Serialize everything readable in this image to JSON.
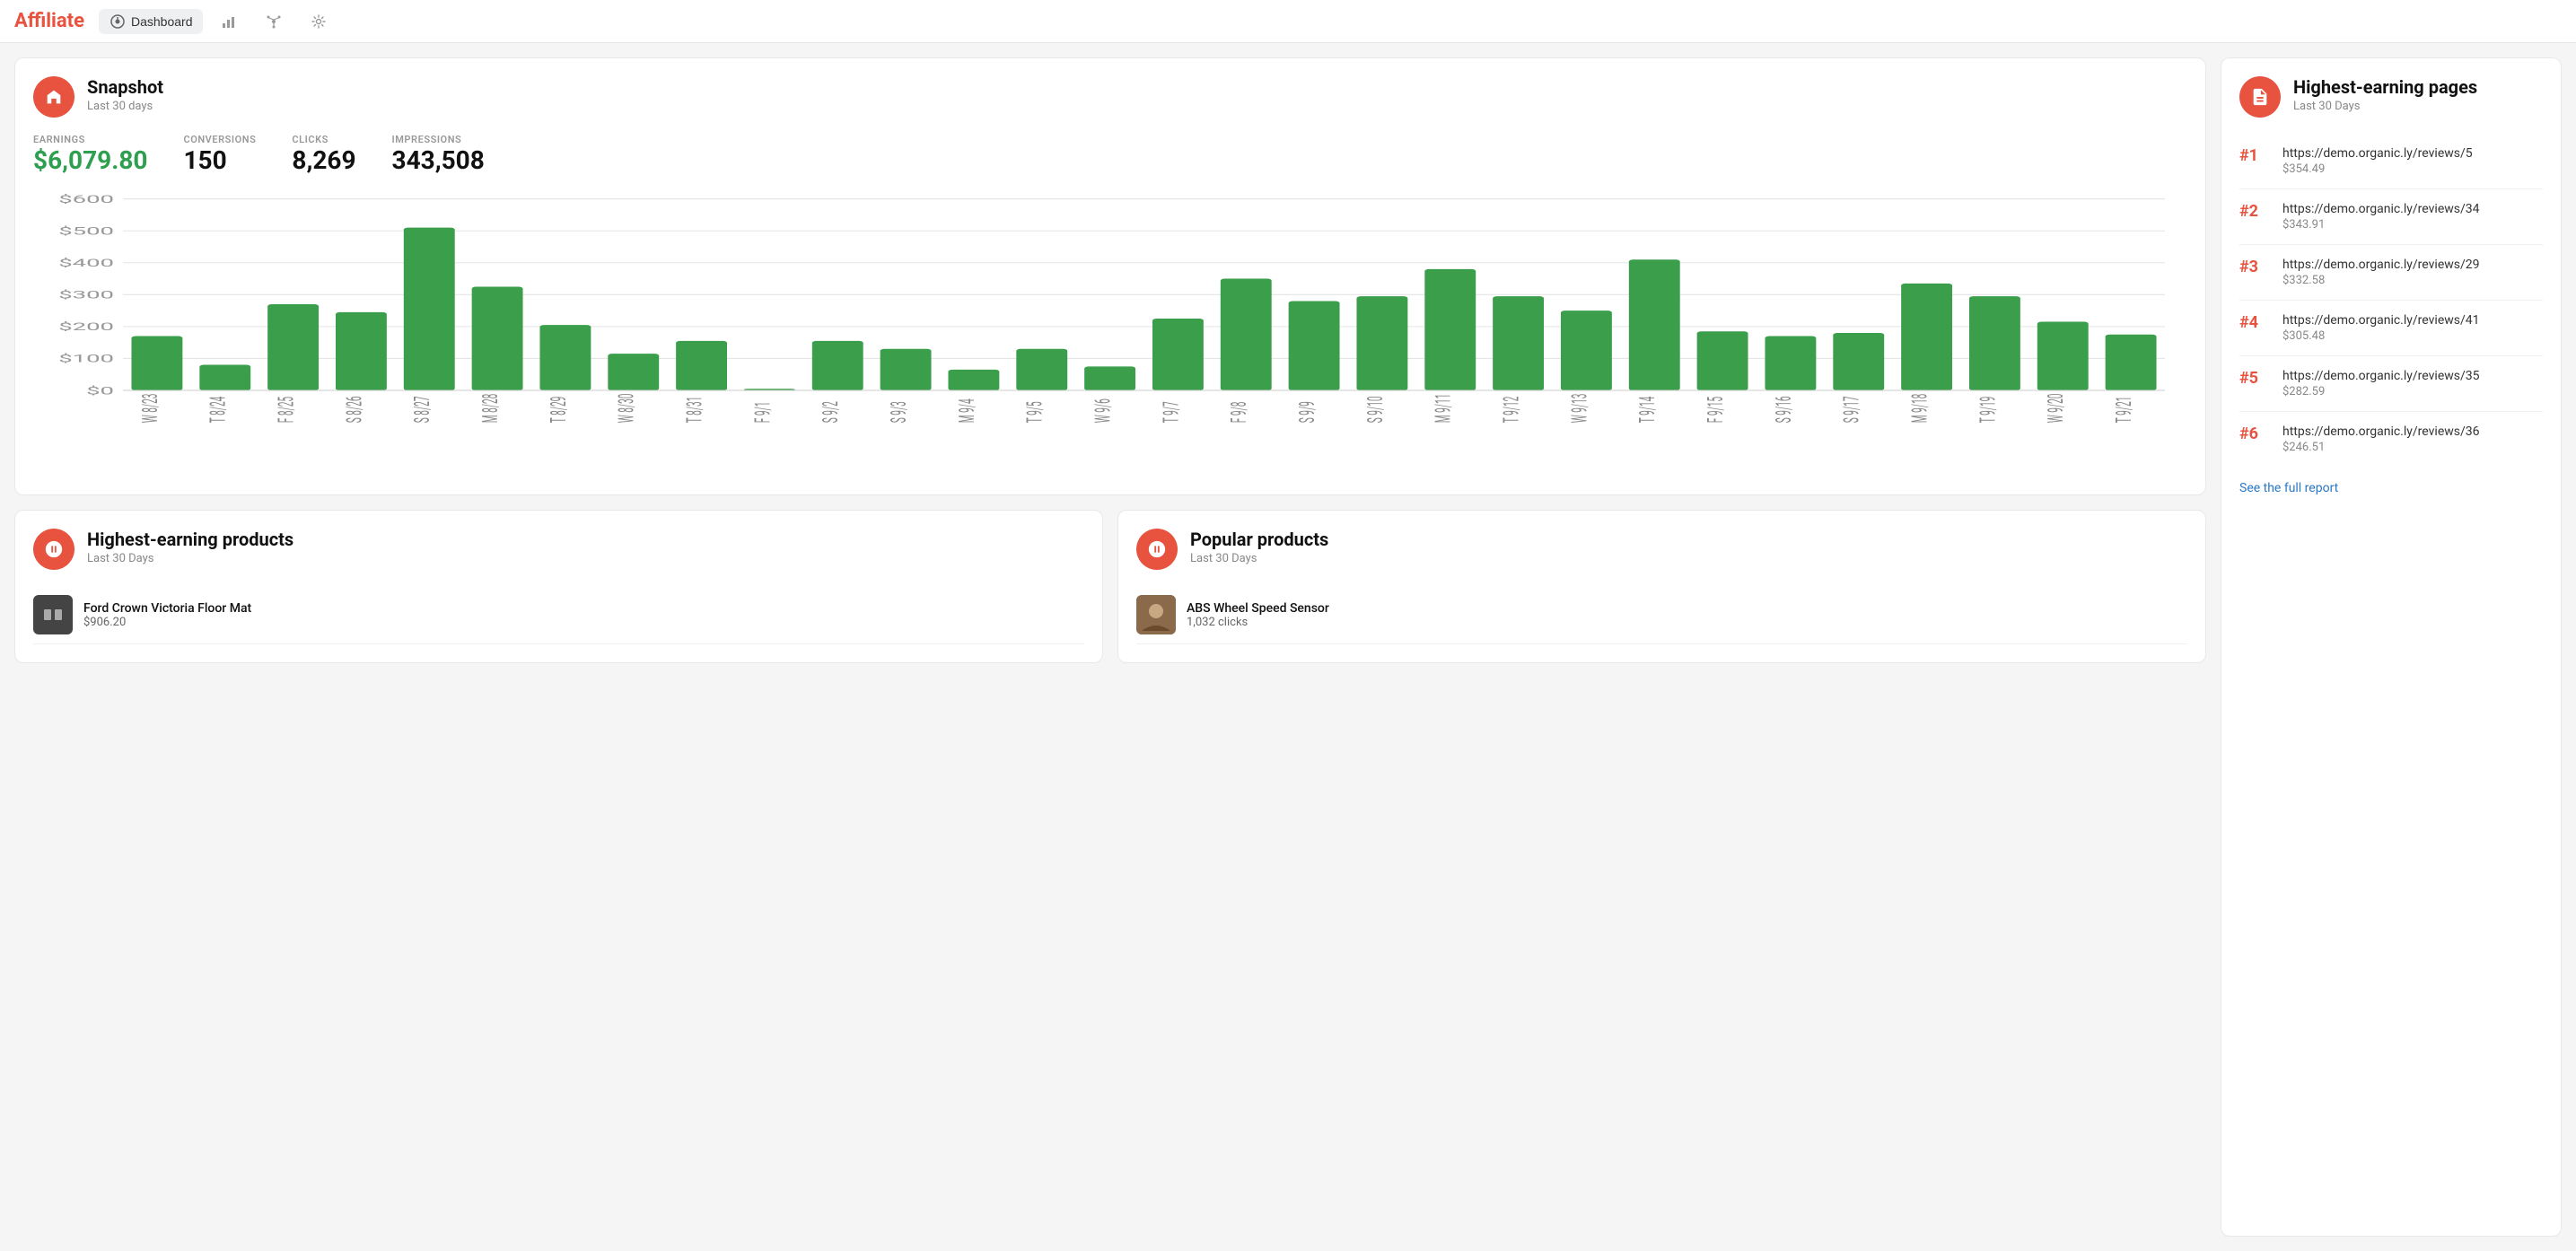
{
  "app": {
    "title": "Affiliate"
  },
  "nav": {
    "dashboard_label": "Dashboard",
    "dashboard_icon": "dashboard",
    "analytics_icon": "bar-chart",
    "network_icon": "network",
    "settings_icon": "settings"
  },
  "snapshot": {
    "title": "Snapshot",
    "subtitle": "Last 30 days",
    "earnings_label": "EARNINGS",
    "earnings_value": "$6,079.80",
    "conversions_label": "CONVERSIONS",
    "conversions_value": "150",
    "clicks_label": "CLICKS",
    "clicks_value": "8,269",
    "impressions_label": "IMPRESSIONS",
    "impressions_value": "343,508"
  },
  "chart": {
    "y_labels": [
      "$600",
      "$500",
      "$400",
      "$300",
      "$200",
      "$100",
      "$0"
    ],
    "bars": [
      {
        "label": "W 8/23",
        "value": 170
      },
      {
        "label": "T 8/24",
        "value": 80
      },
      {
        "label": "F 8/25",
        "value": 270
      },
      {
        "label": "S 8/26",
        "value": 245
      },
      {
        "label": "S 8/27",
        "value": 510
      },
      {
        "label": "M 8/28",
        "value": 325
      },
      {
        "label": "T 8/29",
        "value": 205
      },
      {
        "label": "W 8/30",
        "value": 115
      },
      {
        "label": "T 8/31",
        "value": 155
      },
      {
        "label": "F 9/1",
        "value": 5
      },
      {
        "label": "S 9/2",
        "value": 155
      },
      {
        "label": "S 9/3",
        "value": 130
      },
      {
        "label": "M 9/4",
        "value": 65
      },
      {
        "label": "T 9/5",
        "value": 130
      },
      {
        "label": "W 9/6",
        "value": 75
      },
      {
        "label": "T 9/7",
        "value": 225
      },
      {
        "label": "F 9/8",
        "value": 350
      },
      {
        "label": "S 9/9",
        "value": 280
      },
      {
        "label": "S 9/10",
        "value": 295
      },
      {
        "label": "M 9/11",
        "value": 380
      },
      {
        "label": "T 9/12",
        "value": 295
      },
      {
        "label": "W 9/13",
        "value": 250
      },
      {
        "label": "T 9/14",
        "value": 410
      },
      {
        "label": "F 9/15",
        "value": 185
      },
      {
        "label": "S 9/16",
        "value": 170
      },
      {
        "label": "S 9/17",
        "value": 180
      },
      {
        "label": "M 9/18",
        "value": 335
      },
      {
        "label": "T 9/19",
        "value": 295
      },
      {
        "label": "W 9/20",
        "value": 215
      },
      {
        "label": "T 9/21",
        "value": 175
      }
    ],
    "max_value": 600
  },
  "highest_earning_pages": {
    "title": "Highest-earning pages",
    "subtitle": "Last 30 Days",
    "see_report_label": "See the full report",
    "items": [
      {
        "rank": "#1",
        "url": "https://demo.organic.ly/reviews/5",
        "earning": "$354.49"
      },
      {
        "rank": "#2",
        "url": "https://demo.organic.ly/reviews/34",
        "earning": "$343.91"
      },
      {
        "rank": "#3",
        "url": "https://demo.organic.ly/reviews/29",
        "earning": "$332.58"
      },
      {
        "rank": "#4",
        "url": "https://demo.organic.ly/reviews/41",
        "earning": "$305.48"
      },
      {
        "rank": "#5",
        "url": "https://demo.organic.ly/reviews/35",
        "earning": "$282.59"
      },
      {
        "rank": "#6",
        "url": "https://demo.organic.ly/reviews/36",
        "earning": "$246.51"
      }
    ]
  },
  "highest_earning_products": {
    "title": "Highest-earning products",
    "subtitle": "Last 30 Days",
    "items": [
      {
        "name": "Ford Crown Victoria Floor Mat",
        "value": "$906.20",
        "thumb_type": "dark"
      }
    ]
  },
  "popular_products": {
    "title": "Popular products",
    "subtitle": "Last 30 Days",
    "items": [
      {
        "name": "ABS Wheel Speed Sensor",
        "value": "1,032 clicks",
        "thumb_type": "img"
      }
    ]
  }
}
